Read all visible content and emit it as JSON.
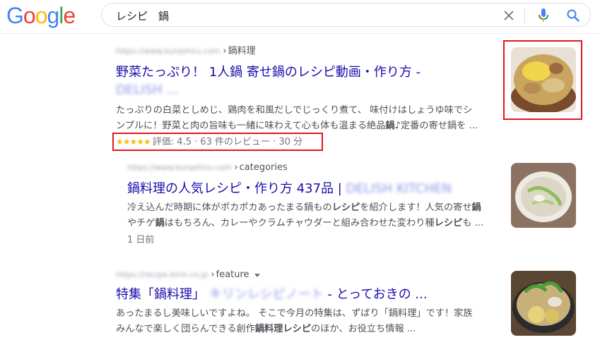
{
  "search": {
    "query": "レシピ　鍋",
    "logo_letters": [
      {
        "ch": "G",
        "color": "#4285F4"
      },
      {
        "ch": "o",
        "color": "#EA4335"
      },
      {
        "ch": "o",
        "color": "#FBBC05"
      },
      {
        "ch": "g",
        "color": "#4285F4"
      },
      {
        "ch": "l",
        "color": "#34A853"
      },
      {
        "ch": "e",
        "color": "#EA4335"
      }
    ]
  },
  "results": [
    {
      "url_blur": "https://www.kurashiru.com",
      "crumb": "鍋料理",
      "title": "野菜たっぷり！ 1人鍋 寄せ鍋のレシピ動画・作り方 -",
      "site_blur": "DELISH ...",
      "snippet_1": "たっぷりの白菜としめじ、鶏肉を和風だしでじっくり煮て、 味付けはしょうゆ味でシ",
      "snippet_2_a": "ンプルに！野菜と肉の旨味も一緒に味わえて心も体も温まる絶品",
      "snippet_2_b": "鍋",
      "snippet_2_c": "♪定番の寄せ鍋を ...",
      "stars": "★★★★★",
      "rating": "評価: 4.5 · 63 件のレビュー · 30 分"
    },
    {
      "url_blur": "https://www.kurashiru.com",
      "crumb": "categories",
      "title": "鍋料理の人気レシピ・作り方 437品 |",
      "site_blur": "DELISH KITCHEN",
      "snippet_1_a": "冷え込んだ時期に体がポカポカあったまる鍋もの",
      "snippet_1_b": "レシピ",
      "snippet_1_c": "を紹介します！人気の寄せ",
      "snippet_1_d": "鍋",
      "snippet_2_a": "やチゲ",
      "snippet_2_b": "鍋",
      "snippet_2_c": "はもちろん、カレーやクラムチャウダーと組み合わせた変わり種",
      "snippet_2_d": "レシピ",
      "snippet_2_e": "も ...",
      "date": "1 日前"
    },
    {
      "url_blur": "https://recipe.kirin.co.jp",
      "crumb": "feature",
      "title_a": "特集「鍋料理」",
      "site_blur": "キリンレシピノート",
      "title_b": "- とっておきの ...",
      "snippet_1": "あったまるし美味しいですよね。 そこで今月の特集は、ずばり「鍋料理」です！家族",
      "snippet_2_a": "みんなで楽しく団らんできる創作",
      "snippet_2_b": "鍋料理レシピ",
      "snippet_2_c": "のほか、お役立ち情報 ..."
    }
  ]
}
